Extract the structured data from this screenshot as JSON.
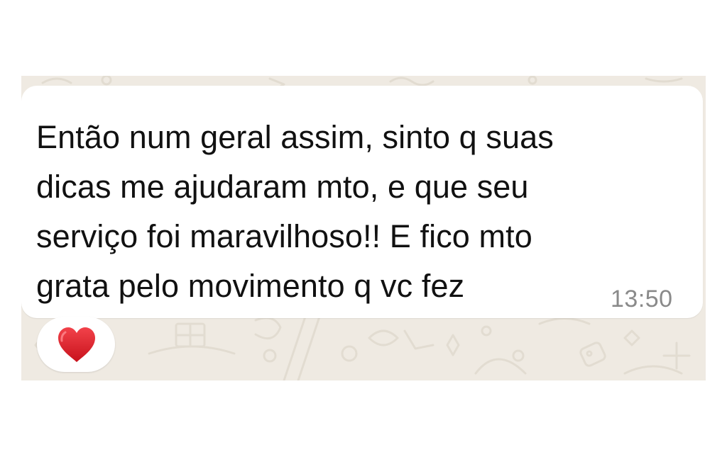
{
  "message": {
    "text": "Então num geral assim, sinto q suas\ndicas me ajudaram mto, e que seu\nserviço foi maravilhoso!! E fico mto\ngrata pelo movimento q vc fez",
    "time": "13:50"
  },
  "reaction": {
    "emoji": "red-heart-icon"
  },
  "colors": {
    "chat_background": "#efeae2",
    "bubble": "#ffffff",
    "text": "#111111",
    "timestamp": "#8a8a8a",
    "heart": "#e0202a"
  }
}
